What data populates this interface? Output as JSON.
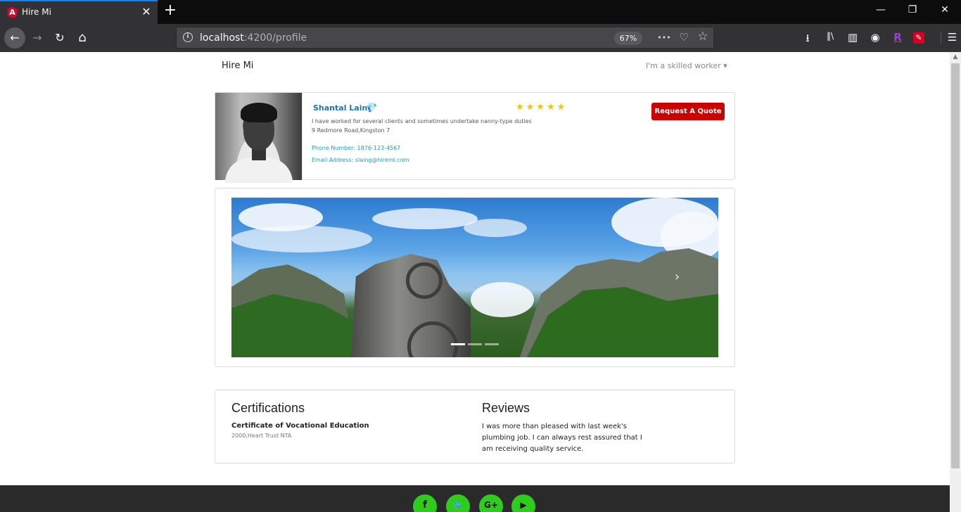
{
  "browser": {
    "tab_title": "Hire Mi",
    "tab_favicon": "A",
    "close_glyph": "✕",
    "newtab_glyph": "+",
    "url_host": "localhost",
    "url_path": ":4200/profile",
    "zoom": "67%",
    "more_glyph": "•••",
    "minimize_glyph": "—",
    "restore_glyph": "❐",
    "close_window_glyph": "✕",
    "back_glyph": "←",
    "forward_glyph": "→",
    "reload_glyph": "↻",
    "home_glyph": "⌂",
    "info_glyph": "i",
    "pocket_glyph": "♡",
    "bookmark_glyph": "☆",
    "download_glyph": "⭳",
    "library_glyph": "‖\\",
    "sidebar_glyph": "▥",
    "sync_glyph": "◉",
    "ext_r_glyph": "R",
    "ext_red_glyph": "✎",
    "menu_glyph": "☰"
  },
  "header": {
    "brand": "Hire Mi",
    "role_dropdown": "I'm a skilled worker ▾"
  },
  "profile": {
    "name": "Shantal Laing",
    "badge_glyph": "💎",
    "bio": "I have worked for several clients and sometimes undertake nanny-type duties",
    "address": "9 Redmore Road,Kingston 7",
    "phone": "Phone Number: 1876-123-4567",
    "email": "Email Address: slaing@hiremi.com",
    "rating": 5,
    "stars": "★★★★★",
    "quote_button": "Request A Quote"
  },
  "carousel": {
    "next_glyph": "›",
    "slide_count": 3,
    "active_index": 0
  },
  "certifications": {
    "title": "Certifications",
    "items": [
      {
        "name": "Certificate of Vocational Education",
        "meta": "2000,Heart Trust NTA"
      }
    ]
  },
  "reviews": {
    "title": "Reviews",
    "items": [
      {
        "text": "I was more than pleased with last week's plumbing job. I can always rest assured that I am receiving quality service."
      }
    ]
  },
  "footer": {
    "social": [
      {
        "icon": "facebook-icon",
        "glyph": "f"
      },
      {
        "icon": "twitter-icon",
        "glyph": "🐦"
      },
      {
        "icon": "google-plus-icon",
        "glyph": "G+"
      },
      {
        "icon": "youtube-icon",
        "glyph": "▶"
      }
    ]
  },
  "colors": {
    "accent_blue": "#1e73be",
    "quote_red": "#cc0000",
    "star_yellow": "#f7c300",
    "contact_teal": "#17a2b8",
    "social_green": "#2ecc1c",
    "footer_bg": "#2a2a2a"
  }
}
